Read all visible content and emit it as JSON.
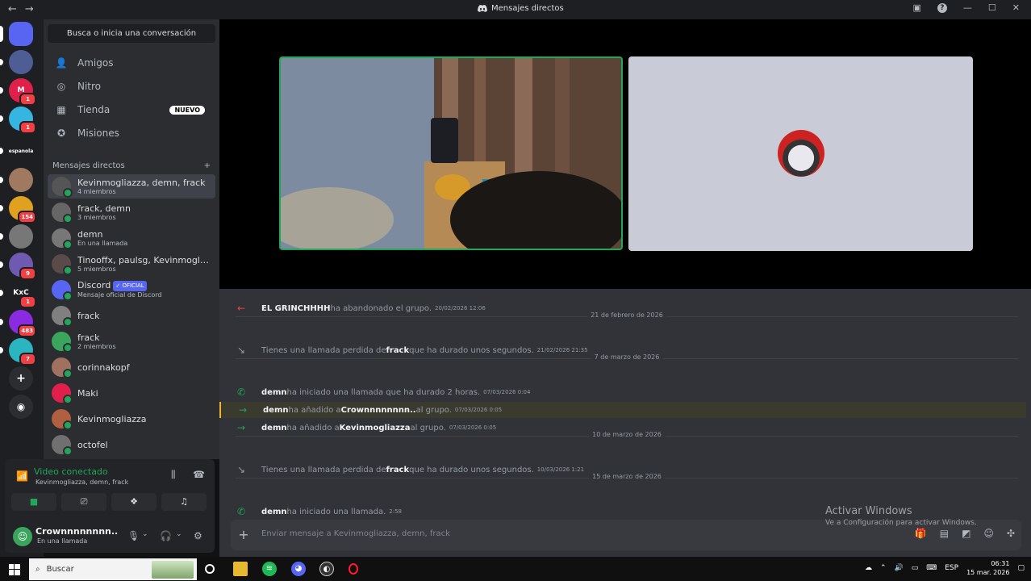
{
  "titlebar": {
    "back": "←",
    "forward": "→",
    "title": "Mensajes directos",
    "help": "?"
  },
  "rail": [
    {
      "name": "discord-home",
      "color": "#5865f2",
      "label": "",
      "badge": ""
    },
    {
      "name": "server-avatar-1",
      "color": "#4e5d94",
      "label": "",
      "badge": ""
    },
    {
      "name": "server-m",
      "color": "#e01f4b",
      "label": "M",
      "badge": "1"
    },
    {
      "name": "server-face",
      "color": "#36b5e0",
      "label": "",
      "badge": "1"
    },
    {
      "name": "server-espaniola",
      "color": "#1e1f22",
      "label": "espanola",
      "badge": ""
    },
    {
      "name": "server-avatar-2",
      "color": "#a07a60",
      "label": "",
      "badge": ""
    },
    {
      "name": "server-avatar-3",
      "color": "#e0a020",
      "label": "",
      "badge": "154"
    },
    {
      "name": "server-avatar-4",
      "color": "#777777",
      "label": "",
      "badge": ""
    },
    {
      "name": "server-avatar-5",
      "color": "#6e5ab0",
      "label": "",
      "badge": "9"
    },
    {
      "name": "server-kxc",
      "color": "#1e1f22",
      "label": "KxC",
      "badge": "1"
    },
    {
      "name": "server-avatar-6",
      "color": "#8a2be2",
      "label": "",
      "badge": "483"
    },
    {
      "name": "server-avatar-7",
      "color": "#2ab5c0",
      "label": "",
      "badge": "7"
    }
  ],
  "sidebar": {
    "search": "Busca o inicia una conversación",
    "nav": [
      {
        "label": "Amigos"
      },
      {
        "label": "Nitro"
      },
      {
        "label": "Tienda",
        "badge": "NUEVO"
      },
      {
        "label": "Misiones"
      }
    ],
    "dm_header": "Mensajes directos",
    "dms": [
      {
        "name": "Kevinmogliazza, demn, frack",
        "sub": "4 miembros",
        "color": "#555555",
        "active": true
      },
      {
        "name": "frack, demn",
        "sub": "3 miembros",
        "color": "#666666"
      },
      {
        "name": "demn",
        "sub": "En una llamada",
        "color": "#777777"
      },
      {
        "name": "Tinooffx, paulsg, Kevinmogliaz...",
        "sub": "5 miembros",
        "color": "#5a4a4a"
      },
      {
        "name": "Discord",
        "badge": "✓ OFICIAL",
        "sub": "Mensaje oficial de Discord",
        "color": "#5865f2"
      },
      {
        "name": "frack",
        "sub": "",
        "color": "#808080"
      },
      {
        "name": "frack",
        "sub": "2 miembros",
        "color": "#3ba55d"
      },
      {
        "name": "corinnakopf",
        "sub": "",
        "color": "#a07060"
      },
      {
        "name": "Maki",
        "sub": "",
        "color": "#e01f4b"
      },
      {
        "name": "Kevinmogliazza",
        "sub": "",
        "color": "#b06040"
      },
      {
        "name": "octofel",
        "sub": "",
        "color": "#707070"
      }
    ]
  },
  "voice": {
    "status": "Video conectado",
    "channel": "Kevinmogliazza, demn, frack"
  },
  "user": {
    "name": "Crownnnnnnnn..",
    "status": "En una llamada"
  },
  "messages": [
    {
      "type": "leave",
      "user": "EL GRINCHHHH",
      "text": " ha abandonado el grupo.",
      "ts": "20/02/2026 12:06"
    },
    {
      "type": "sep",
      "text": "21 de febrero de 2026"
    },
    {
      "type": "missed",
      "pre": "Tienes una llamada perdida de ",
      "user": "frack",
      "text": " que ha durado unos segundos.",
      "ts": "21/02/2026 21:35"
    },
    {
      "type": "sep",
      "text": "7 de marzo de 2026"
    },
    {
      "type": "call",
      "user": "demn",
      "text": " ha iniciado una llamada que ha durado 2 horas.",
      "ts": "07/03/2026 0:04"
    },
    {
      "type": "add",
      "user": "demn",
      "text": " ha añadido a ",
      "target": "Crownnnnnnnn..",
      "post": " al grupo.",
      "ts": "07/03/2026 0:05",
      "highlight": true
    },
    {
      "type": "add",
      "user": "demn",
      "text": " ha añadido a ",
      "target": "Kevinmogliazza",
      "post": " al grupo.",
      "ts": "07/03/2026 0:05"
    },
    {
      "type": "sep",
      "text": "10 de marzo de 2026"
    },
    {
      "type": "missed",
      "pre": "Tienes una llamada perdida de ",
      "user": "frack",
      "text": " que ha durado unos segundos.",
      "ts": "10/03/2026 1:21"
    },
    {
      "type": "sep",
      "text": "15 de marzo de 2026"
    },
    {
      "type": "call",
      "user": "demn",
      "text": " ha iniciado una llamada.",
      "ts": "2:58"
    }
  ],
  "composer": {
    "placeholder": "Enviar mensaje a Kevinmogliazza, demn, frack"
  },
  "activate": {
    "title": "Activar Windows",
    "sub": "Ve a Configuración para activar Windows."
  },
  "taskbar": {
    "search": "Buscar",
    "lang": "ESP",
    "time": "06:31",
    "date": "15 mar. 2026"
  },
  "colors": {
    "accent": "#5865f2",
    "online": "#23a55a",
    "danger": "#f23f43"
  }
}
